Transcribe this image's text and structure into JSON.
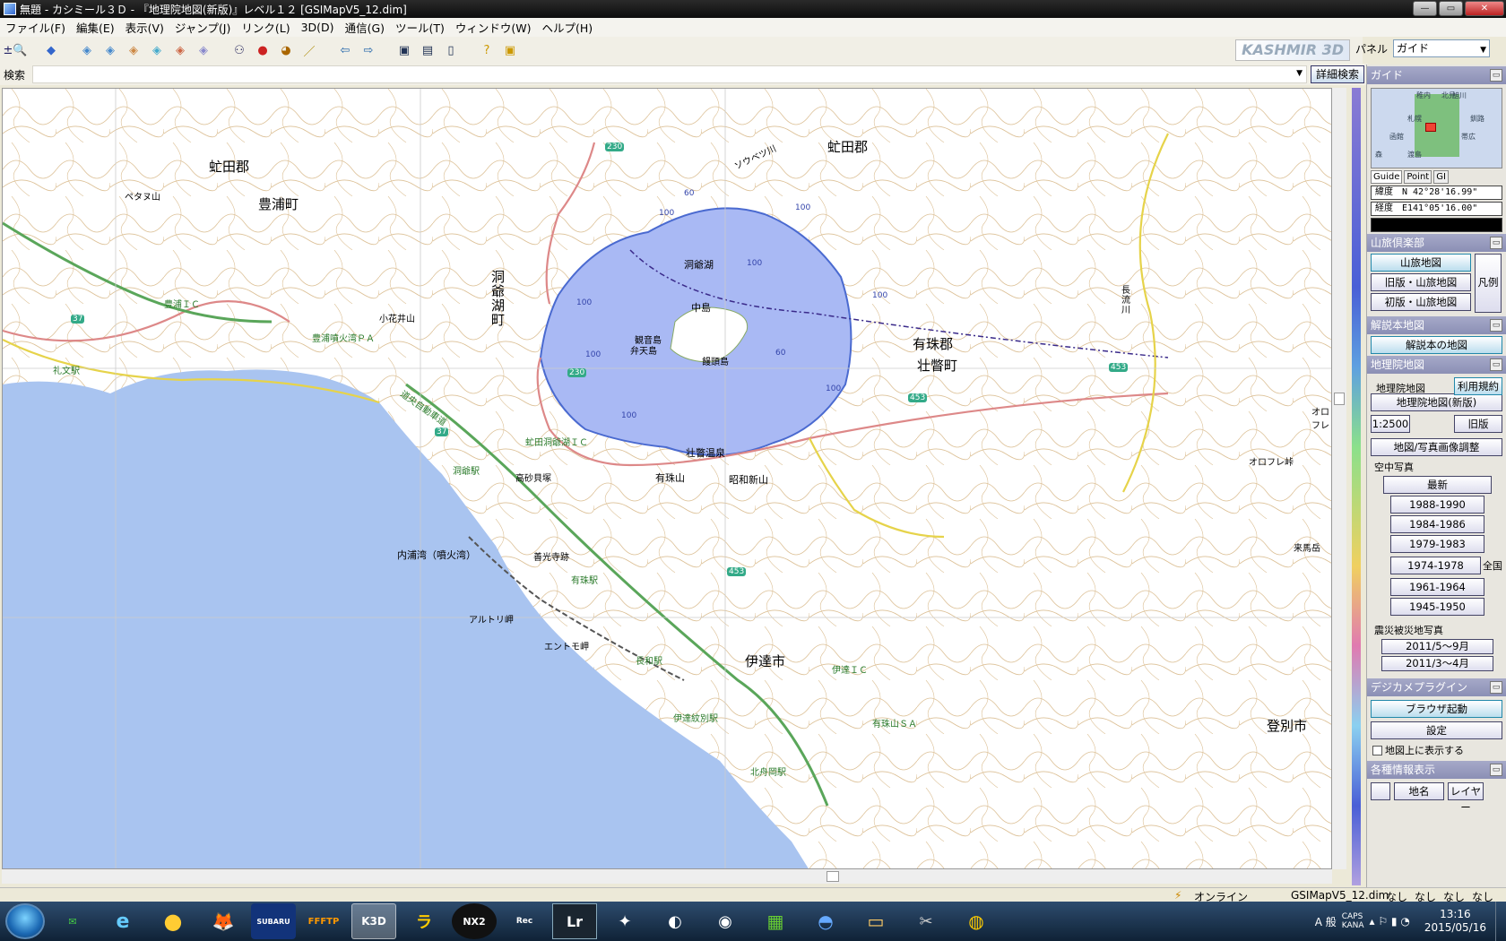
{
  "window": {
    "title": "無題 - カシミール３Ｄ - 『地理院地図(新版)』レベル１２ [GSIMapV5_12.dim]"
  },
  "menu": [
    "ファイル(F)",
    "編集(E)",
    "表示(V)",
    "ジャンプ(J)",
    "リンク(L)",
    "3D(D)",
    "通信(G)",
    "ツール(T)",
    "ウィンドウ(W)",
    "ヘルプ(H)"
  ],
  "logo": "KASHMIR 3D",
  "panel": {
    "label": "パネル",
    "value": "ガイド"
  },
  "search": {
    "label": "検索",
    "value": "",
    "detail_btn": "詳細検索"
  },
  "map": {
    "labels": {
      "toyako_lake": "洞爺湖",
      "nakajima": "中島",
      "kannonjima": "観音島",
      "bentenjima": "弁天島",
      "manjujima": "饅頭島",
      "toyako_town": "洞爺湖町",
      "toyoura_town": "豊浦町",
      "abuta_gun_w": "虻田郡",
      "abuta_gun_ne": "虻田郡",
      "usu_gun": "有珠郡",
      "sobetsu_town": "壮瞥町",
      "date_city": "伊達市",
      "noboribetsu_city": "登別市",
      "uchiura_bay": "内浦湾（噴火湾）",
      "usuzan": "有珠山",
      "showa_shinzan": "昭和新山",
      "sobetsu_onsen": "壮瞥温泉",
      "toya_sta": "洞爺駅",
      "usu_sta": "有珠駅",
      "nagawa_sta": "長和駅",
      "date_monbetsu_sta": "伊達紋別駅",
      "kitafunaoka_sta": "北舟岡駅",
      "reibun_sta": "礼文駅",
      "toyoura_ic": "豊浦ＩＣ",
      "date_ic": "伊達ＩＣ",
      "abuta_toyako_ic": "虻田洞爺湖ＩＣ",
      "usuzan_sa": "有珠山ＳＡ",
      "toyoura_pa": "豊浦噴火湾ＰＡ",
      "takasago": "高砂貝塚",
      "zenkoji": "善光寺跡",
      "arutori": "アルトリ岬",
      "entomo": "エントモ岬",
      "kobanai": "小花井山",
      "petanu": "ペタヌ山",
      "sakiyama": "ソウベツ川",
      "orofure": "オロフレ峠",
      "kuma": "来馬岳",
      "nagaru": "長流川",
      "expressway": "道央自動車道",
      "ofure": "オロフレ"
    },
    "routes": [
      "230",
      "37",
      "453",
      "453",
      "37",
      "453",
      "230"
    ],
    "contours": [
      "100",
      "60",
      "100",
      "100",
      "100",
      "60",
      "100",
      "100",
      "100",
      "100"
    ]
  },
  "side": {
    "guide": {
      "title": "ガイド",
      "tabs": [
        "Guide",
        "Point",
        "GI"
      ],
      "lat": "緯度　N 42°28'16.99\"",
      "lon": "経度　E141°05'16.00\"",
      "minimap": [
        "稚内",
        "北見",
        "旭川",
        "釧路",
        "札幌",
        "函館",
        "帯広",
        "森",
        "渡島"
      ]
    },
    "sanryo": {
      "title": "山旅倶楽部",
      "btn1": "山旅地図",
      "btn2": "旧版・山旅地図",
      "btn3": "初版・山旅地図",
      "legend": "凡例"
    },
    "kaisetsu": {
      "title": "解説本地図",
      "btn": "解説本の地図"
    },
    "gsi": {
      "title": "地理院地図",
      "terms": "利用規約",
      "label": "地理院地図",
      "btn_new": "地理院地図(新版)",
      "btn_2500": "1:2500",
      "btn_old": "旧版",
      "btn_adjust": "地図/写真画像調整",
      "aerial": "空中写真",
      "latest": "最新",
      "years": [
        "1988-1990",
        "1984-1986",
        "1979-1983",
        "1974-1978",
        "1961-1964",
        "1945-1950"
      ],
      "national": "全国",
      "quake": "震災被災地写真",
      "quake_btns": [
        "2011/5～9月",
        "2011/3～4月"
      ]
    },
    "digicam": {
      "title": "デジカメプラグイン",
      "btn_browser": "ブラウザ起動",
      "btn_settings": "設定",
      "checkbox": "地図上に表示する"
    },
    "info": {
      "title": "各種情報表示",
      "btn_place": "地名",
      "btn_layer": "レイヤー"
    }
  },
  "status": {
    "online": "オンライン",
    "file": "GSIMapV5_12.dim",
    "cells": [
      "なし",
      "なし",
      "なし",
      "なし"
    ]
  },
  "taskbar": {
    "apps": [
      "e",
      "●",
      "🦊",
      "SUBARU",
      "FFFTP",
      "K3D",
      "ラ",
      "NX2",
      "Rec",
      "Lr",
      "✦",
      "◐",
      "◉",
      "▦",
      "◓"
    ],
    "ime": "A 般",
    "time": "13:16",
    "date": "2015/05/16",
    "caps": "CAPS",
    "kana": "KANA"
  }
}
